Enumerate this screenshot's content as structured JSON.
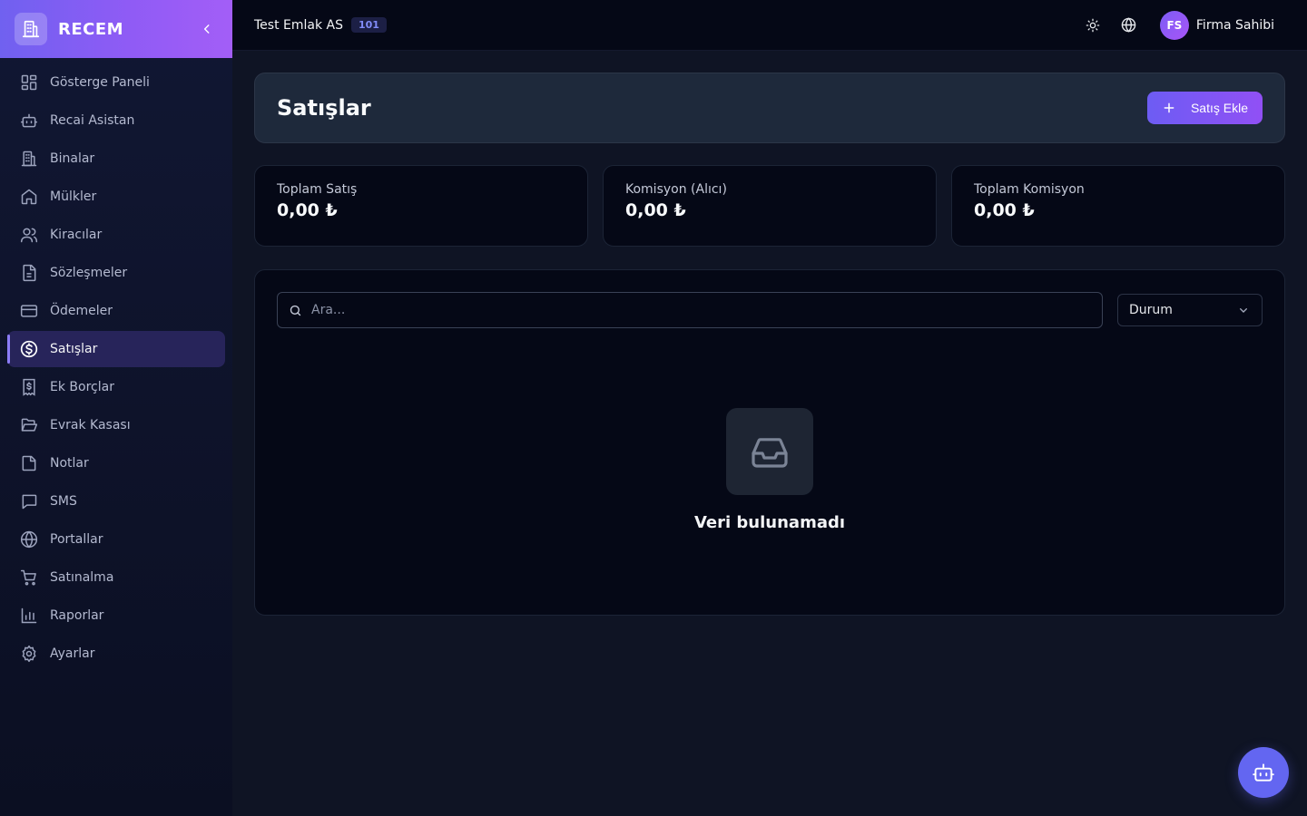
{
  "brand": {
    "name": "RECEM",
    "logo_icon": "building-icon",
    "collapse_icon": "chevron-left-icon"
  },
  "sidebar": {
    "items": [
      {
        "label": "Gösterge Paneli",
        "icon": "dashboard-icon",
        "active": false
      },
      {
        "label": "Recai Asistan",
        "icon": "bot-icon",
        "active": false
      },
      {
        "label": "Binalar",
        "icon": "building-icon",
        "active": false
      },
      {
        "label": "Mülkler",
        "icon": "home-icon",
        "active": false
      },
      {
        "label": "Kiracılar",
        "icon": "users-icon",
        "active": false
      },
      {
        "label": "Sözleşmeler",
        "icon": "document-icon",
        "active": false
      },
      {
        "label": "Ödemeler",
        "icon": "credit-card-icon",
        "active": false
      },
      {
        "label": "Satışlar",
        "icon": "dollar-circle-icon",
        "active": true
      },
      {
        "label": "Ek Borçlar",
        "icon": "receipt-icon",
        "active": false
      },
      {
        "label": "Evrak Kasası",
        "icon": "folder-open-icon",
        "active": false
      },
      {
        "label": "Notlar",
        "icon": "sticky-note-icon",
        "active": false
      },
      {
        "label": "SMS",
        "icon": "message-icon",
        "active": false
      },
      {
        "label": "Portallar",
        "icon": "globe-icon",
        "active": false
      },
      {
        "label": "Satınalma",
        "icon": "cart-icon",
        "active": false
      },
      {
        "label": "Raporlar",
        "icon": "bar-chart-icon",
        "active": false
      },
      {
        "label": "Ayarlar",
        "icon": "gear-icon",
        "active": false
      }
    ]
  },
  "topbar": {
    "company": "Test Emlak AS",
    "company_badge": "101",
    "theme_icon": "sun-icon",
    "language_icon": "globe-icon",
    "user_initials": "FS",
    "user_name": "Firma Sahibi"
  },
  "header": {
    "title": "Satışlar",
    "add_button": "Satış Ekle",
    "add_icon": "plus-icon"
  },
  "stats": [
    {
      "label": "Toplam Satış",
      "value": "0,00 ₺"
    },
    {
      "label": "Komisyon (Alıcı)",
      "value": "0,00 ₺"
    },
    {
      "label": "Toplam Komisyon",
      "value": "0,00 ₺"
    }
  ],
  "filters": {
    "search_placeholder": "Ara...",
    "status_label": "Durum"
  },
  "empty_state": {
    "icon": "inbox-icon",
    "text": "Veri bulunamadı"
  },
  "fab": {
    "icon": "bot-icon"
  },
  "colors": {
    "accent": "#6366f1",
    "brand_gradient_start": "#7061f0",
    "brand_gradient_end": "#a35ef7",
    "active_nav_bg": "#27245a"
  }
}
